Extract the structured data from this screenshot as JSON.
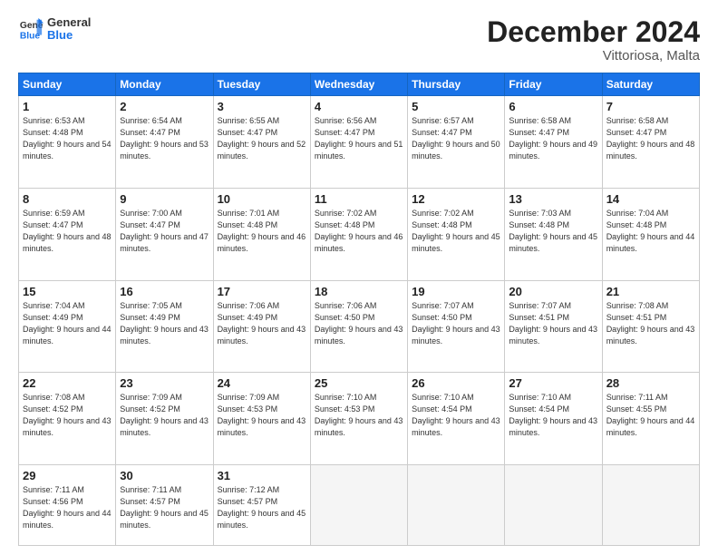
{
  "header": {
    "logo_general": "General",
    "logo_blue": "Blue",
    "month": "December 2024",
    "location": "Vittoriosa, Malta"
  },
  "weekdays": [
    "Sunday",
    "Monday",
    "Tuesday",
    "Wednesday",
    "Thursday",
    "Friday",
    "Saturday"
  ],
  "weeks": [
    [
      {
        "day": "1",
        "rise": "Sunrise: 6:53 AM",
        "set": "Sunset: 4:48 PM",
        "day_text": "Daylight: 9 hours and 54 minutes."
      },
      {
        "day": "2",
        "rise": "Sunrise: 6:54 AM",
        "set": "Sunset: 4:47 PM",
        "day_text": "Daylight: 9 hours and 53 minutes."
      },
      {
        "day": "3",
        "rise": "Sunrise: 6:55 AM",
        "set": "Sunset: 4:47 PM",
        "day_text": "Daylight: 9 hours and 52 minutes."
      },
      {
        "day": "4",
        "rise": "Sunrise: 6:56 AM",
        "set": "Sunset: 4:47 PM",
        "day_text": "Daylight: 9 hours and 51 minutes."
      },
      {
        "day": "5",
        "rise": "Sunrise: 6:57 AM",
        "set": "Sunset: 4:47 PM",
        "day_text": "Daylight: 9 hours and 50 minutes."
      },
      {
        "day": "6",
        "rise": "Sunrise: 6:58 AM",
        "set": "Sunset: 4:47 PM",
        "day_text": "Daylight: 9 hours and 49 minutes."
      },
      {
        "day": "7",
        "rise": "Sunrise: 6:58 AM",
        "set": "Sunset: 4:47 PM",
        "day_text": "Daylight: 9 hours and 48 minutes."
      }
    ],
    [
      {
        "day": "8",
        "rise": "Sunrise: 6:59 AM",
        "set": "Sunset: 4:47 PM",
        "day_text": "Daylight: 9 hours and 48 minutes."
      },
      {
        "day": "9",
        "rise": "Sunrise: 7:00 AM",
        "set": "Sunset: 4:47 PM",
        "day_text": "Daylight: 9 hours and 47 minutes."
      },
      {
        "day": "10",
        "rise": "Sunrise: 7:01 AM",
        "set": "Sunset: 4:48 PM",
        "day_text": "Daylight: 9 hours and 46 minutes."
      },
      {
        "day": "11",
        "rise": "Sunrise: 7:02 AM",
        "set": "Sunset: 4:48 PM",
        "day_text": "Daylight: 9 hours and 46 minutes."
      },
      {
        "day": "12",
        "rise": "Sunrise: 7:02 AM",
        "set": "Sunset: 4:48 PM",
        "day_text": "Daylight: 9 hours and 45 minutes."
      },
      {
        "day": "13",
        "rise": "Sunrise: 7:03 AM",
        "set": "Sunset: 4:48 PM",
        "day_text": "Daylight: 9 hours and 45 minutes."
      },
      {
        "day": "14",
        "rise": "Sunrise: 7:04 AM",
        "set": "Sunset: 4:48 PM",
        "day_text": "Daylight: 9 hours and 44 minutes."
      }
    ],
    [
      {
        "day": "15",
        "rise": "Sunrise: 7:04 AM",
        "set": "Sunset: 4:49 PM",
        "day_text": "Daylight: 9 hours and 44 minutes."
      },
      {
        "day": "16",
        "rise": "Sunrise: 7:05 AM",
        "set": "Sunset: 4:49 PM",
        "day_text": "Daylight: 9 hours and 43 minutes."
      },
      {
        "day": "17",
        "rise": "Sunrise: 7:06 AM",
        "set": "Sunset: 4:49 PM",
        "day_text": "Daylight: 9 hours and 43 minutes."
      },
      {
        "day": "18",
        "rise": "Sunrise: 7:06 AM",
        "set": "Sunset: 4:50 PM",
        "day_text": "Daylight: 9 hours and 43 minutes."
      },
      {
        "day": "19",
        "rise": "Sunrise: 7:07 AM",
        "set": "Sunset: 4:50 PM",
        "day_text": "Daylight: 9 hours and 43 minutes."
      },
      {
        "day": "20",
        "rise": "Sunrise: 7:07 AM",
        "set": "Sunset: 4:51 PM",
        "day_text": "Daylight: 9 hours and 43 minutes."
      },
      {
        "day": "21",
        "rise": "Sunrise: 7:08 AM",
        "set": "Sunset: 4:51 PM",
        "day_text": "Daylight: 9 hours and 43 minutes."
      }
    ],
    [
      {
        "day": "22",
        "rise": "Sunrise: 7:08 AM",
        "set": "Sunset: 4:52 PM",
        "day_text": "Daylight: 9 hours and 43 minutes."
      },
      {
        "day": "23",
        "rise": "Sunrise: 7:09 AM",
        "set": "Sunset: 4:52 PM",
        "day_text": "Daylight: 9 hours and 43 minutes."
      },
      {
        "day": "24",
        "rise": "Sunrise: 7:09 AM",
        "set": "Sunset: 4:53 PM",
        "day_text": "Daylight: 9 hours and 43 minutes."
      },
      {
        "day": "25",
        "rise": "Sunrise: 7:10 AM",
        "set": "Sunset: 4:53 PM",
        "day_text": "Daylight: 9 hours and 43 minutes."
      },
      {
        "day": "26",
        "rise": "Sunrise: 7:10 AM",
        "set": "Sunset: 4:54 PM",
        "day_text": "Daylight: 9 hours and 43 minutes."
      },
      {
        "day": "27",
        "rise": "Sunrise: 7:10 AM",
        "set": "Sunset: 4:54 PM",
        "day_text": "Daylight: 9 hours and 43 minutes."
      },
      {
        "day": "28",
        "rise": "Sunrise: 7:11 AM",
        "set": "Sunset: 4:55 PM",
        "day_text": "Daylight: 9 hours and 44 minutes."
      }
    ],
    [
      {
        "day": "29",
        "rise": "Sunrise: 7:11 AM",
        "set": "Sunset: 4:56 PM",
        "day_text": "Daylight: 9 hours and 44 minutes."
      },
      {
        "day": "30",
        "rise": "Sunrise: 7:11 AM",
        "set": "Sunset: 4:57 PM",
        "day_text": "Daylight: 9 hours and 45 minutes."
      },
      {
        "day": "31",
        "rise": "Sunrise: 7:12 AM",
        "set": "Sunset: 4:57 PM",
        "day_text": "Daylight: 9 hours and 45 minutes."
      },
      {
        "day": "",
        "rise": "",
        "set": "",
        "day_text": ""
      },
      {
        "day": "",
        "rise": "",
        "set": "",
        "day_text": ""
      },
      {
        "day": "",
        "rise": "",
        "set": "",
        "day_text": ""
      },
      {
        "day": "",
        "rise": "",
        "set": "",
        "day_text": ""
      }
    ]
  ]
}
